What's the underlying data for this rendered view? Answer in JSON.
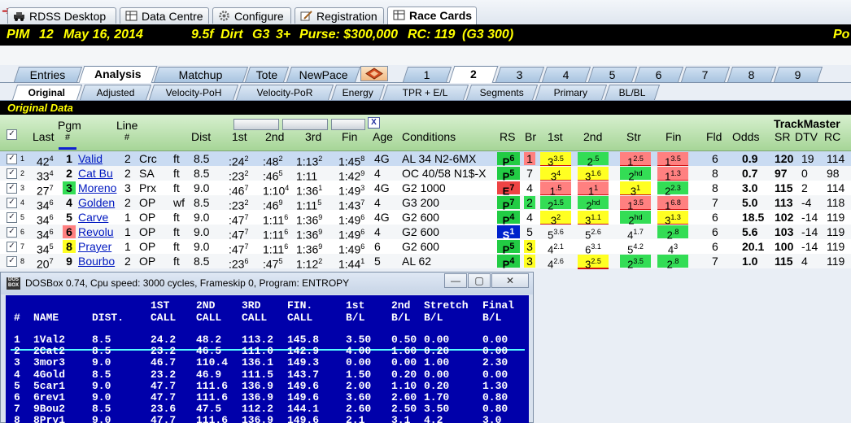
{
  "top_tabs": [
    {
      "label": "RDSS Desktop",
      "icon": "car-icon"
    },
    {
      "label": "Data Centre",
      "icon": "table-icon"
    },
    {
      "label": "Configure",
      "icon": "gear-icon"
    },
    {
      "label": "Registration",
      "icon": "pencil-icon"
    },
    {
      "label": "Race Cards",
      "icon": "table-icon",
      "active": true
    }
  ],
  "race_header": {
    "track": "PIM",
    "race": "12",
    "date": "May 16, 2014",
    "distance": "9.5f",
    "surface": "Dirt",
    "grade": "G3",
    "age": "3+",
    "purse": "Purse: $300,000",
    "rc": "RC: 119",
    "rc_class": "(G3 300)",
    "right": "Po"
  },
  "view_tabs": [
    "Entries",
    "Analysis",
    "Matchup",
    "Tote",
    "NewPace"
  ],
  "race_tabs": [
    "1",
    "2",
    "3",
    "4",
    "5",
    "6",
    "7",
    "8",
    "9"
  ],
  "active_race_tab": "2",
  "sub_tabs": [
    "Original",
    "Adjusted",
    "Velocity-PoH",
    "Velocity-PoR",
    "Energy",
    "TPR + E/L",
    "Segments",
    "Primary",
    "BL/BL"
  ],
  "section_title": "Original Data",
  "columns": {
    "last": "Last",
    "pgm": "Pgm",
    "pgm_hash": "#",
    "line": "Line",
    "line_hash": "#",
    "dist": "Dist",
    "c1": "1st",
    "c2": "2nd",
    "c3": "3rd",
    "fin": "Fin",
    "age": "Age",
    "conditions": "Conditions",
    "rs": "RS",
    "br": "Br",
    "p1": "1st",
    "p2": "2nd",
    "str": "Str",
    "pfin": "Fin",
    "fld": "Fld",
    "odds": "Odds",
    "trackmaster": "TrackMaster",
    "sr": "SR",
    "dtv": "DTV",
    "rc": "RC",
    "x": "X"
  },
  "rows": [
    {
      "n": "1",
      "last": "42",
      "last_sup": "4",
      "pgm": "1",
      "name": "Valid",
      "line": "2",
      "line_trk": "Crc",
      "surf": "ft",
      "dist": "8.5",
      "c1": ":24",
      "c1s": "2",
      "c2": ":48",
      "c2s": "2",
      "c3": "1:13",
      "c3s": "2",
      "fin": "1:45",
      "fins": "8",
      "age": "4G",
      "cond": "AL 34 N2-6MX",
      "rs": "P",
      "rss": "6",
      "br": "1",
      "p1": "3",
      "p1s": "3.5",
      "p2": "2",
      "p2s": ".5",
      "st": "1",
      "sts": "2.5",
      "pf": "1",
      "pfs": "3.5",
      "fld": "6",
      "odds": "0.9",
      "sr": "120",
      "dtv": "19",
      "rc": "114"
    },
    {
      "n": "2",
      "last": "33",
      "last_sup": "4",
      "pgm": "2",
      "name": "Cat Bu",
      "line": "2",
      "line_trk": "SA",
      "surf": "ft",
      "dist": "8.5",
      "c1": ":23",
      "c1s": "2",
      "c2": ":46",
      "c2s": "5",
      "c3": "1:11",
      "c3s": "",
      "fin": "1:42",
      "fins": "9",
      "age": "4",
      "cond": "OC 40/58 N1$-X",
      "rs": "P",
      "rss": "5",
      "br": "7",
      "p1": "3",
      "p1s": "4",
      "p2": "3",
      "p2s": "1.6",
      "st": "2",
      "sts": "hd",
      "pf": "1",
      "pfs": "1.3",
      "fld": "8",
      "odds": "0.7",
      "sr": "97",
      "dtv": "0",
      "rc": "98"
    },
    {
      "n": "3",
      "last": "27",
      "last_sup": "7",
      "pgm": "3",
      "name": "Moreno",
      "line": "3",
      "line_trk": "Prx",
      "surf": "ft",
      "dist": "9.0",
      "c1": ":46",
      "c1s": "7",
      "c2": "1:10",
      "c2s": "4",
      "c3": "1:36",
      "c3s": "1",
      "fin": "1:49",
      "fins": "3",
      "age": "4G",
      "cond": "G2 1000",
      "rs": "E",
      "rss": "7",
      "br": "4",
      "p1": "1",
      "p1s": ".5",
      "p2": "1",
      "p2s": "1",
      "st": "3",
      "sts": "1",
      "pf": "2",
      "pfs": "2.3",
      "fld": "8",
      "odds": "3.0",
      "sr": "115",
      "dtv": "2",
      "rc": "114"
    },
    {
      "n": "4",
      "last": "34",
      "last_sup": "6",
      "pgm": "4",
      "name": "Golden",
      "line": "2",
      "line_trk": "OP",
      "surf": "wf",
      "dist": "8.5",
      "c1": ":23",
      "c1s": "2",
      "c2": ":46",
      "c2s": "9",
      "c3": "1:11",
      "c3s": "5",
      "fin": "1:43",
      "fins": "7",
      "age": "4",
      "cond": "G3 200",
      "rs": "P",
      "rss": "7",
      "br": "2",
      "p1": "2",
      "p1s": "1.5",
      "p2": "2",
      "p2s": "hd",
      "st": "1",
      "sts": "3.5",
      "pf": "1",
      "pfs": "6.8",
      "fld": "7",
      "odds": "5.0",
      "sr": "113",
      "dtv": "-4",
      "rc": "118"
    },
    {
      "n": "5",
      "last": "34",
      "last_sup": "6",
      "pgm": "5",
      "name": "Carve",
      "line": "1",
      "line_trk": "OP",
      "surf": "ft",
      "dist": "9.0",
      "c1": ":47",
      "c1s": "7",
      "c2": "1:11",
      "c2s": "6",
      "c3": "1:36",
      "c3s": "9",
      "fin": "1:49",
      "fins": "6",
      "age": "4G",
      "cond": "G2 600",
      "rs": "P",
      "rss": "4",
      "br": "4",
      "p1": "3",
      "p1s": "2",
      "p2": "3",
      "p2s": "1.1",
      "st": "2",
      "sts": "hd",
      "pf": "3",
      "pfs": "1.3",
      "fld": "6",
      "odds": "18.5",
      "sr": "102",
      "dtv": "-14",
      "rc": "119"
    },
    {
      "n": "6",
      "last": "34",
      "last_sup": "6",
      "pgm": "6",
      "name": "Revolu",
      "line": "1",
      "line_trk": "OP",
      "surf": "ft",
      "dist": "9.0",
      "c1": ":47",
      "c1s": "7",
      "c2": "1:11",
      "c2s": "6",
      "c3": "1:36",
      "c3s": "9",
      "fin": "1:49",
      "fins": "6",
      "age": "4",
      "cond": "G2 600",
      "rs": "S",
      "rss": "1",
      "br": "5",
      "p1": "5",
      "p1s": "3.6",
      "p2": "5",
      "p2s": "2.6",
      "st": "4",
      "sts": "1.7",
      "pf": "2",
      "pfs": ".8",
      "fld": "6",
      "odds": "5.6",
      "sr": "103",
      "dtv": "-14",
      "rc": "119"
    },
    {
      "n": "7",
      "last": "34",
      "last_sup": "5",
      "pgm": "8",
      "name": "Prayer",
      "line": "1",
      "line_trk": "OP",
      "surf": "ft",
      "dist": "9.0",
      "c1": ":47",
      "c1s": "7",
      "c2": "1:11",
      "c2s": "6",
      "c3": "1:36",
      "c3s": "9",
      "fin": "1:49",
      "fins": "6",
      "age": "6",
      "cond": "G2 600",
      "rs": "P",
      "rss": "5",
      "br": "3",
      "p1": "4",
      "p1s": "2.1",
      "p2": "6",
      "p2s": "3.1",
      "st": "5",
      "sts": "4.2",
      "pf": "4",
      "pfs": "3",
      "fld": "6",
      "odds": "20.1",
      "sr": "100",
      "dtv": "-14",
      "rc": "119"
    },
    {
      "n": "8",
      "last": "20",
      "last_sup": "7",
      "pgm": "9",
      "name": "Bourbo",
      "line": "2",
      "line_trk": "OP",
      "surf": "ft",
      "dist": "8.5",
      "c1": ":23",
      "c1s": "6",
      "c2": ":47",
      "c2s": "5",
      "c3": "1:12",
      "c3s": "2",
      "fin": "1:44",
      "fins": "1",
      "age": "5",
      "cond": "AL 62",
      "rs": "P",
      "rss": "4",
      "br": "3",
      "p1": "4",
      "p1s": "2.6",
      "p2": "3",
      "p2s": "2.5",
      "st": "2",
      "sts": "3.5",
      "pf": "2",
      "pfs": ".8",
      "fld": "7",
      "odds": "1.0",
      "sr": "115",
      "dtv": "4",
      "rc": "119"
    }
  ],
  "dosbox": {
    "title": "DOSBox 0.74, Cpu speed:     3000 cycles, Frameskip  0, Program:  ENTROPY",
    "min": "—",
    "restore": "▢",
    "close": "✕",
    "headers_top": [
      "",
      "",
      "",
      "1ST",
      "2ND",
      "3RD",
      "FIN.",
      "1st",
      "2nd",
      "Stretch",
      "Final"
    ],
    "headers_bottom": [
      "#",
      "NAME",
      "DIST.",
      "CALL",
      "CALL",
      "CALL",
      "CALL",
      "B/L",
      "B/L",
      "B/L",
      "B/L"
    ],
    "rows": [
      [
        "1",
        "1Val2",
        "8.5",
        "24.2",
        "48.2",
        "113.2",
        "145.8",
        "3.50",
        "0.50",
        "0.00",
        "0.00"
      ],
      [
        "2",
        "2Cat2",
        "8.5",
        "23.2",
        "46.5",
        "111.0",
        "142.9",
        "4.00",
        "1.60",
        "0.20",
        "0.00"
      ],
      [
        "3",
        "3mor3",
        "9.0",
        "46.7",
        "110.4",
        "136.1",
        "149.3",
        "0.00",
        "0.00",
        "1.00",
        "2.30"
      ],
      [
        "4",
        "4Gold",
        "8.5",
        "23.2",
        "46.9",
        "111.5",
        "143.7",
        "1.50",
        "0.20",
        "0.00",
        "0.00"
      ],
      [
        "5",
        "5car1",
        "9.0",
        "47.7",
        "111.6",
        "136.9",
        "149.6",
        "2.00",
        "1.10",
        "0.20",
        "1.30"
      ],
      [
        "6",
        "6rev1",
        "9.0",
        "47.7",
        "111.6",
        "136.9",
        "149.6",
        "3.60",
        "2.60",
        "1.70",
        "0.80"
      ],
      [
        "7",
        "9Bou2",
        "8.5",
        "23.6",
        "47.5",
        "112.2",
        "144.1",
        "2.60",
        "2.50",
        "3.50",
        "0.80"
      ],
      [
        "8",
        "8Pry1",
        "9.0",
        "47.7",
        "111.6",
        "136.9",
        "149.6",
        "2.1",
        "3.1",
        "4.2",
        "3.0"
      ]
    ]
  },
  "colors": {
    "header_yellow": "#ffff00",
    "rs_green": "#22cc44",
    "rs_red": "#ee4444",
    "rs_blue": "#0022cc",
    "green_box": "#33dd55",
    "yellow_box": "#ffff22",
    "red_box": "#ff8080",
    "dos_blue": "#0000aa"
  }
}
